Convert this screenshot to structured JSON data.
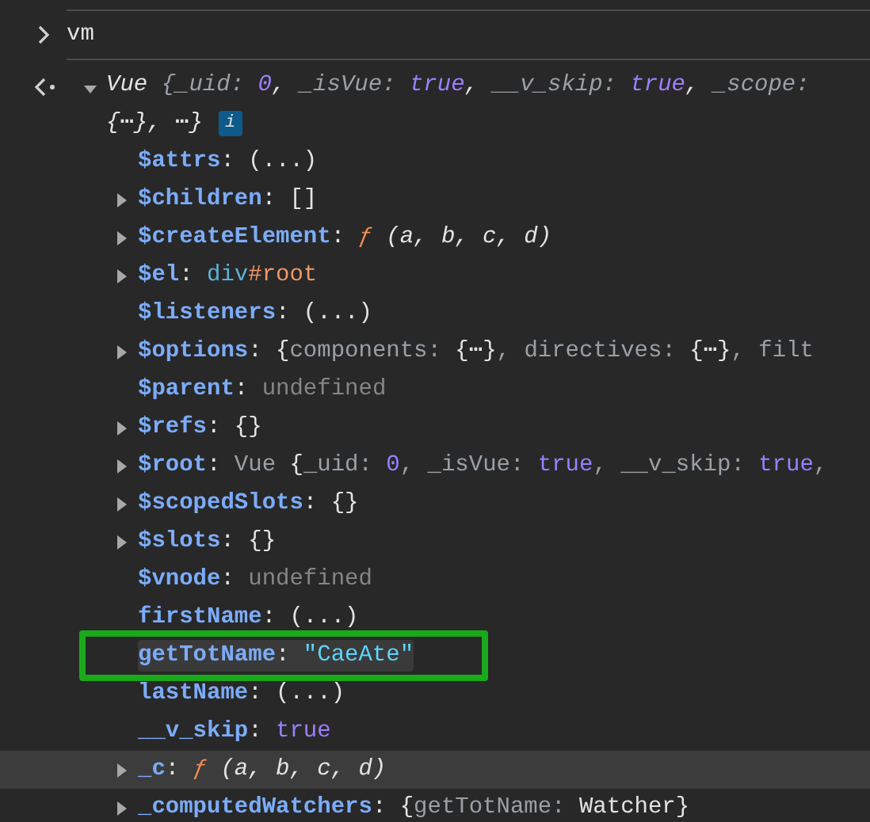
{
  "console": {
    "input": {
      "text": "vm"
    },
    "result": {
      "expanded": true,
      "summary_lines": [
        [
          {
            "kind": "italic",
            "text": "Vue  "
          },
          {
            "kind": "italic-dim",
            "text": "{_uid: "
          },
          {
            "kind": "italic-keyword",
            "text": "0"
          },
          {
            "kind": "italic",
            "text": ", "
          },
          {
            "kind": "italic-dim",
            "text": "_isVue: "
          },
          {
            "kind": "italic-keyword",
            "text": "true"
          },
          {
            "kind": "italic",
            "text": ", "
          },
          {
            "kind": "italic-dim",
            "text": "__v_skip: "
          },
          {
            "kind": "italic-keyword",
            "text": "true"
          },
          {
            "kind": "italic",
            "text": ", "
          },
          {
            "kind": "italic-dim",
            "text": "_scope:"
          }
        ],
        [
          {
            "kind": "italic",
            "text": "{⋯},   ⋯}"
          }
        ]
      ],
      "info_badge": "i",
      "properties": [
        {
          "key": "$attrs",
          "expandable": false,
          "hovered": false,
          "boxed": false,
          "segments": [
            {
              "kind": "plain",
              "text": ": "
            },
            {
              "kind": "plain",
              "text": "(...)"
            }
          ]
        },
        {
          "key": "$children",
          "expandable": true,
          "hovered": false,
          "boxed": false,
          "segments": [
            {
              "kind": "plain",
              "text": ": "
            },
            {
              "kind": "plain",
              "text": "[]"
            }
          ]
        },
        {
          "key": "$createElement",
          "expandable": true,
          "hovered": false,
          "boxed": false,
          "segments": [
            {
              "kind": "plain",
              "text": ": "
            },
            {
              "kind": "func",
              "text": "ƒ"
            },
            {
              "kind": "args",
              "text": " (a,  b,  c,  d)"
            }
          ]
        },
        {
          "key": "$el",
          "expandable": true,
          "hovered": false,
          "boxed": false,
          "segments": [
            {
              "kind": "plain",
              "text": ": "
            },
            {
              "kind": "node-tag",
              "text": "div"
            },
            {
              "kind": "node-id",
              "text": "#root"
            }
          ]
        },
        {
          "key": "$listeners",
          "expandable": false,
          "hovered": false,
          "boxed": false,
          "segments": [
            {
              "kind": "plain",
              "text": ": "
            },
            {
              "kind": "plain",
              "text": "(...)"
            }
          ]
        },
        {
          "key": "$options",
          "expandable": true,
          "hovered": false,
          "boxed": false,
          "segments": [
            {
              "kind": "plain",
              "text": ": "
            },
            {
              "kind": "plain",
              "text": "{"
            },
            {
              "kind": "dim",
              "text": "components: "
            },
            {
              "kind": "plain",
              "text": "{⋯}"
            },
            {
              "kind": "dim",
              "text": ", directives: "
            },
            {
              "kind": "plain",
              "text": "{⋯}"
            },
            {
              "kind": "dim",
              "text": ", filt"
            }
          ]
        },
        {
          "key": "$parent",
          "expandable": false,
          "hovered": false,
          "boxed": false,
          "segments": [
            {
              "kind": "plain",
              "text": ": "
            },
            {
              "kind": "undefined",
              "text": "undefined"
            }
          ]
        },
        {
          "key": "$refs",
          "expandable": true,
          "hovered": false,
          "boxed": false,
          "segments": [
            {
              "kind": "plain",
              "text": ": "
            },
            {
              "kind": "plain",
              "text": "{}"
            }
          ]
        },
        {
          "key": "$root",
          "expandable": true,
          "hovered": false,
          "boxed": false,
          "segments": [
            {
              "kind": "plain",
              "text": ": "
            },
            {
              "kind": "dim",
              "text": "Vue  "
            },
            {
              "kind": "plain",
              "text": "{"
            },
            {
              "kind": "dim",
              "text": "_uid: "
            },
            {
              "kind": "keyword",
              "text": "0"
            },
            {
              "kind": "dim",
              "text": ", _isVue: "
            },
            {
              "kind": "keyword",
              "text": "true"
            },
            {
              "kind": "dim",
              "text": ", __v_skip: "
            },
            {
              "kind": "keyword",
              "text": "true"
            },
            {
              "kind": "dim",
              "text": ","
            }
          ]
        },
        {
          "key": "$scopedSlots",
          "expandable": true,
          "hovered": false,
          "boxed": false,
          "segments": [
            {
              "kind": "plain",
              "text": ": "
            },
            {
              "kind": "plain",
              "text": "{}"
            }
          ]
        },
        {
          "key": "$slots",
          "expandable": true,
          "hovered": false,
          "boxed": false,
          "segments": [
            {
              "kind": "plain",
              "text": ": "
            },
            {
              "kind": "plain",
              "text": "{}"
            }
          ]
        },
        {
          "key": "$vnode",
          "expandable": false,
          "hovered": false,
          "boxed": false,
          "segments": [
            {
              "kind": "plain",
              "text": ": "
            },
            {
              "kind": "undefined",
              "text": "undefined"
            }
          ]
        },
        {
          "key": "firstName",
          "expandable": false,
          "hovered": false,
          "boxed": false,
          "segments": [
            {
              "kind": "plain",
              "text": ": "
            },
            {
              "kind": "plain",
              "text": "(...)"
            }
          ]
        },
        {
          "key": "getTotName",
          "expandable": false,
          "hovered": false,
          "boxed": true,
          "segments": [
            {
              "kind": "plain",
              "text": ": "
            },
            {
              "kind": "string",
              "text": "\"CaeAte\""
            }
          ]
        },
        {
          "key": "lastName",
          "expandable": false,
          "hovered": false,
          "boxed": false,
          "segments": [
            {
              "kind": "plain",
              "text": ": "
            },
            {
              "kind": "plain",
              "text": "(...)"
            }
          ]
        },
        {
          "key": "__v_skip",
          "expandable": false,
          "hovered": false,
          "boxed": false,
          "segments": [
            {
              "kind": "plain",
              "text": ": "
            },
            {
              "kind": "keyword",
              "text": "true"
            }
          ]
        },
        {
          "key": "_c",
          "expandable": true,
          "hovered": true,
          "boxed": false,
          "segments": [
            {
              "kind": "plain",
              "text": ": "
            },
            {
              "kind": "func",
              "text": "ƒ"
            },
            {
              "kind": "args",
              "text": " (a,  b,  c,  d)"
            }
          ]
        },
        {
          "key": "_computedWatchers",
          "expandable": true,
          "hovered": false,
          "boxed": false,
          "segments": [
            {
              "kind": "plain",
              "text": ": "
            },
            {
              "kind": "plain",
              "text": "{"
            },
            {
              "kind": "dim",
              "text": "getTotName: "
            },
            {
              "kind": "plain",
              "text": "Watcher}"
            }
          ]
        }
      ]
    }
  }
}
